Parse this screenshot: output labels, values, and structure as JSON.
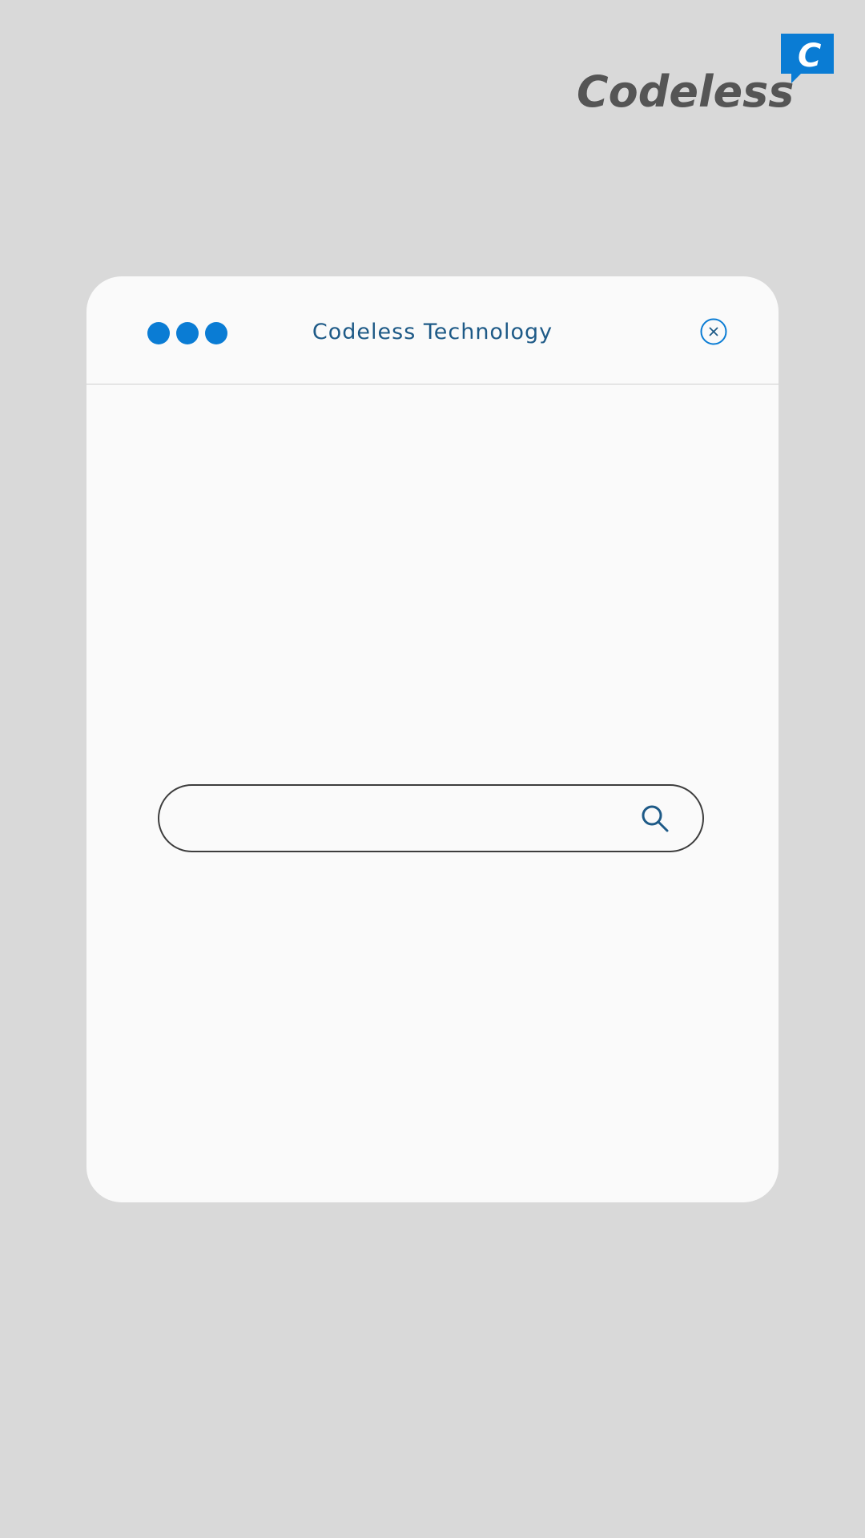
{
  "logo": {
    "wordmark": "Codeless",
    "badge_letter": "C",
    "wordmark_color": "#555555",
    "badge_color": "#0a7cd4"
  },
  "window": {
    "title": "Codeless Technology",
    "title_color": "#1e5a87",
    "dot_color": "#0a7cd4",
    "menu_icon": "three-dots-icon",
    "close_icon": "close-circle-icon"
  },
  "search": {
    "value": "",
    "placeholder": "",
    "icon": "search-icon",
    "icon_color": "#1e5a87"
  }
}
